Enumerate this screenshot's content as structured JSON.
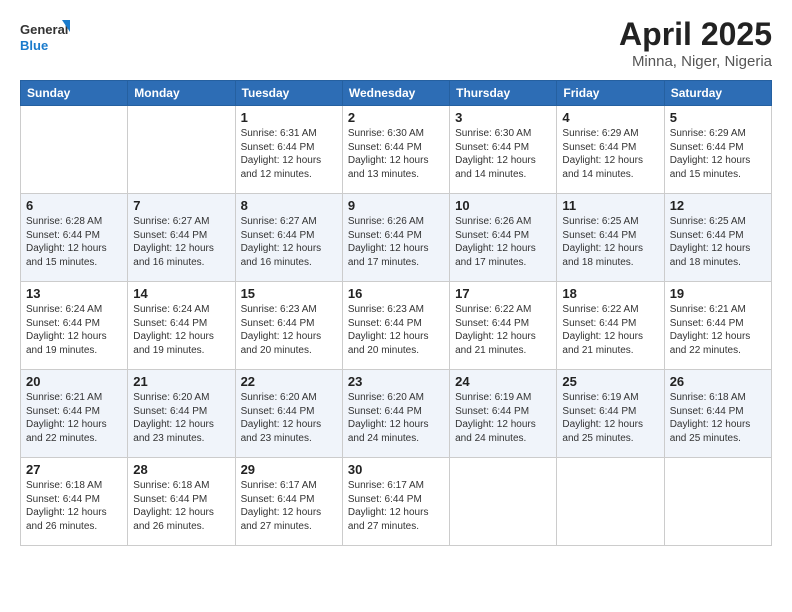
{
  "logo": {
    "line1": "General",
    "line2": "Blue"
  },
  "title": "April 2025",
  "subtitle": "Minna, Niger, Nigeria",
  "weekdays": [
    "Sunday",
    "Monday",
    "Tuesday",
    "Wednesday",
    "Thursday",
    "Friday",
    "Saturday"
  ],
  "weeks": [
    [
      {
        "day": "",
        "info": ""
      },
      {
        "day": "",
        "info": ""
      },
      {
        "day": "1",
        "info": "Sunrise: 6:31 AM\nSunset: 6:44 PM\nDaylight: 12 hours and 12 minutes."
      },
      {
        "day": "2",
        "info": "Sunrise: 6:30 AM\nSunset: 6:44 PM\nDaylight: 12 hours and 13 minutes."
      },
      {
        "day": "3",
        "info": "Sunrise: 6:30 AM\nSunset: 6:44 PM\nDaylight: 12 hours and 14 minutes."
      },
      {
        "day": "4",
        "info": "Sunrise: 6:29 AM\nSunset: 6:44 PM\nDaylight: 12 hours and 14 minutes."
      },
      {
        "day": "5",
        "info": "Sunrise: 6:29 AM\nSunset: 6:44 PM\nDaylight: 12 hours and 15 minutes."
      }
    ],
    [
      {
        "day": "6",
        "info": "Sunrise: 6:28 AM\nSunset: 6:44 PM\nDaylight: 12 hours and 15 minutes."
      },
      {
        "day": "7",
        "info": "Sunrise: 6:27 AM\nSunset: 6:44 PM\nDaylight: 12 hours and 16 minutes."
      },
      {
        "day": "8",
        "info": "Sunrise: 6:27 AM\nSunset: 6:44 PM\nDaylight: 12 hours and 16 minutes."
      },
      {
        "day": "9",
        "info": "Sunrise: 6:26 AM\nSunset: 6:44 PM\nDaylight: 12 hours and 17 minutes."
      },
      {
        "day": "10",
        "info": "Sunrise: 6:26 AM\nSunset: 6:44 PM\nDaylight: 12 hours and 17 minutes."
      },
      {
        "day": "11",
        "info": "Sunrise: 6:25 AM\nSunset: 6:44 PM\nDaylight: 12 hours and 18 minutes."
      },
      {
        "day": "12",
        "info": "Sunrise: 6:25 AM\nSunset: 6:44 PM\nDaylight: 12 hours and 18 minutes."
      }
    ],
    [
      {
        "day": "13",
        "info": "Sunrise: 6:24 AM\nSunset: 6:44 PM\nDaylight: 12 hours and 19 minutes."
      },
      {
        "day": "14",
        "info": "Sunrise: 6:24 AM\nSunset: 6:44 PM\nDaylight: 12 hours and 19 minutes."
      },
      {
        "day": "15",
        "info": "Sunrise: 6:23 AM\nSunset: 6:44 PM\nDaylight: 12 hours and 20 minutes."
      },
      {
        "day": "16",
        "info": "Sunrise: 6:23 AM\nSunset: 6:44 PM\nDaylight: 12 hours and 20 minutes."
      },
      {
        "day": "17",
        "info": "Sunrise: 6:22 AM\nSunset: 6:44 PM\nDaylight: 12 hours and 21 minutes."
      },
      {
        "day": "18",
        "info": "Sunrise: 6:22 AM\nSunset: 6:44 PM\nDaylight: 12 hours and 21 minutes."
      },
      {
        "day": "19",
        "info": "Sunrise: 6:21 AM\nSunset: 6:44 PM\nDaylight: 12 hours and 22 minutes."
      }
    ],
    [
      {
        "day": "20",
        "info": "Sunrise: 6:21 AM\nSunset: 6:44 PM\nDaylight: 12 hours and 22 minutes."
      },
      {
        "day": "21",
        "info": "Sunrise: 6:20 AM\nSunset: 6:44 PM\nDaylight: 12 hours and 23 minutes."
      },
      {
        "day": "22",
        "info": "Sunrise: 6:20 AM\nSunset: 6:44 PM\nDaylight: 12 hours and 23 minutes."
      },
      {
        "day": "23",
        "info": "Sunrise: 6:20 AM\nSunset: 6:44 PM\nDaylight: 12 hours and 24 minutes."
      },
      {
        "day": "24",
        "info": "Sunrise: 6:19 AM\nSunset: 6:44 PM\nDaylight: 12 hours and 24 minutes."
      },
      {
        "day": "25",
        "info": "Sunrise: 6:19 AM\nSunset: 6:44 PM\nDaylight: 12 hours and 25 minutes."
      },
      {
        "day": "26",
        "info": "Sunrise: 6:18 AM\nSunset: 6:44 PM\nDaylight: 12 hours and 25 minutes."
      }
    ],
    [
      {
        "day": "27",
        "info": "Sunrise: 6:18 AM\nSunset: 6:44 PM\nDaylight: 12 hours and 26 minutes."
      },
      {
        "day": "28",
        "info": "Sunrise: 6:18 AM\nSunset: 6:44 PM\nDaylight: 12 hours and 26 minutes."
      },
      {
        "day": "29",
        "info": "Sunrise: 6:17 AM\nSunset: 6:44 PM\nDaylight: 12 hours and 27 minutes."
      },
      {
        "day": "30",
        "info": "Sunrise: 6:17 AM\nSunset: 6:44 PM\nDaylight: 12 hours and 27 minutes."
      },
      {
        "day": "",
        "info": ""
      },
      {
        "day": "",
        "info": ""
      },
      {
        "day": "",
        "info": ""
      }
    ]
  ]
}
